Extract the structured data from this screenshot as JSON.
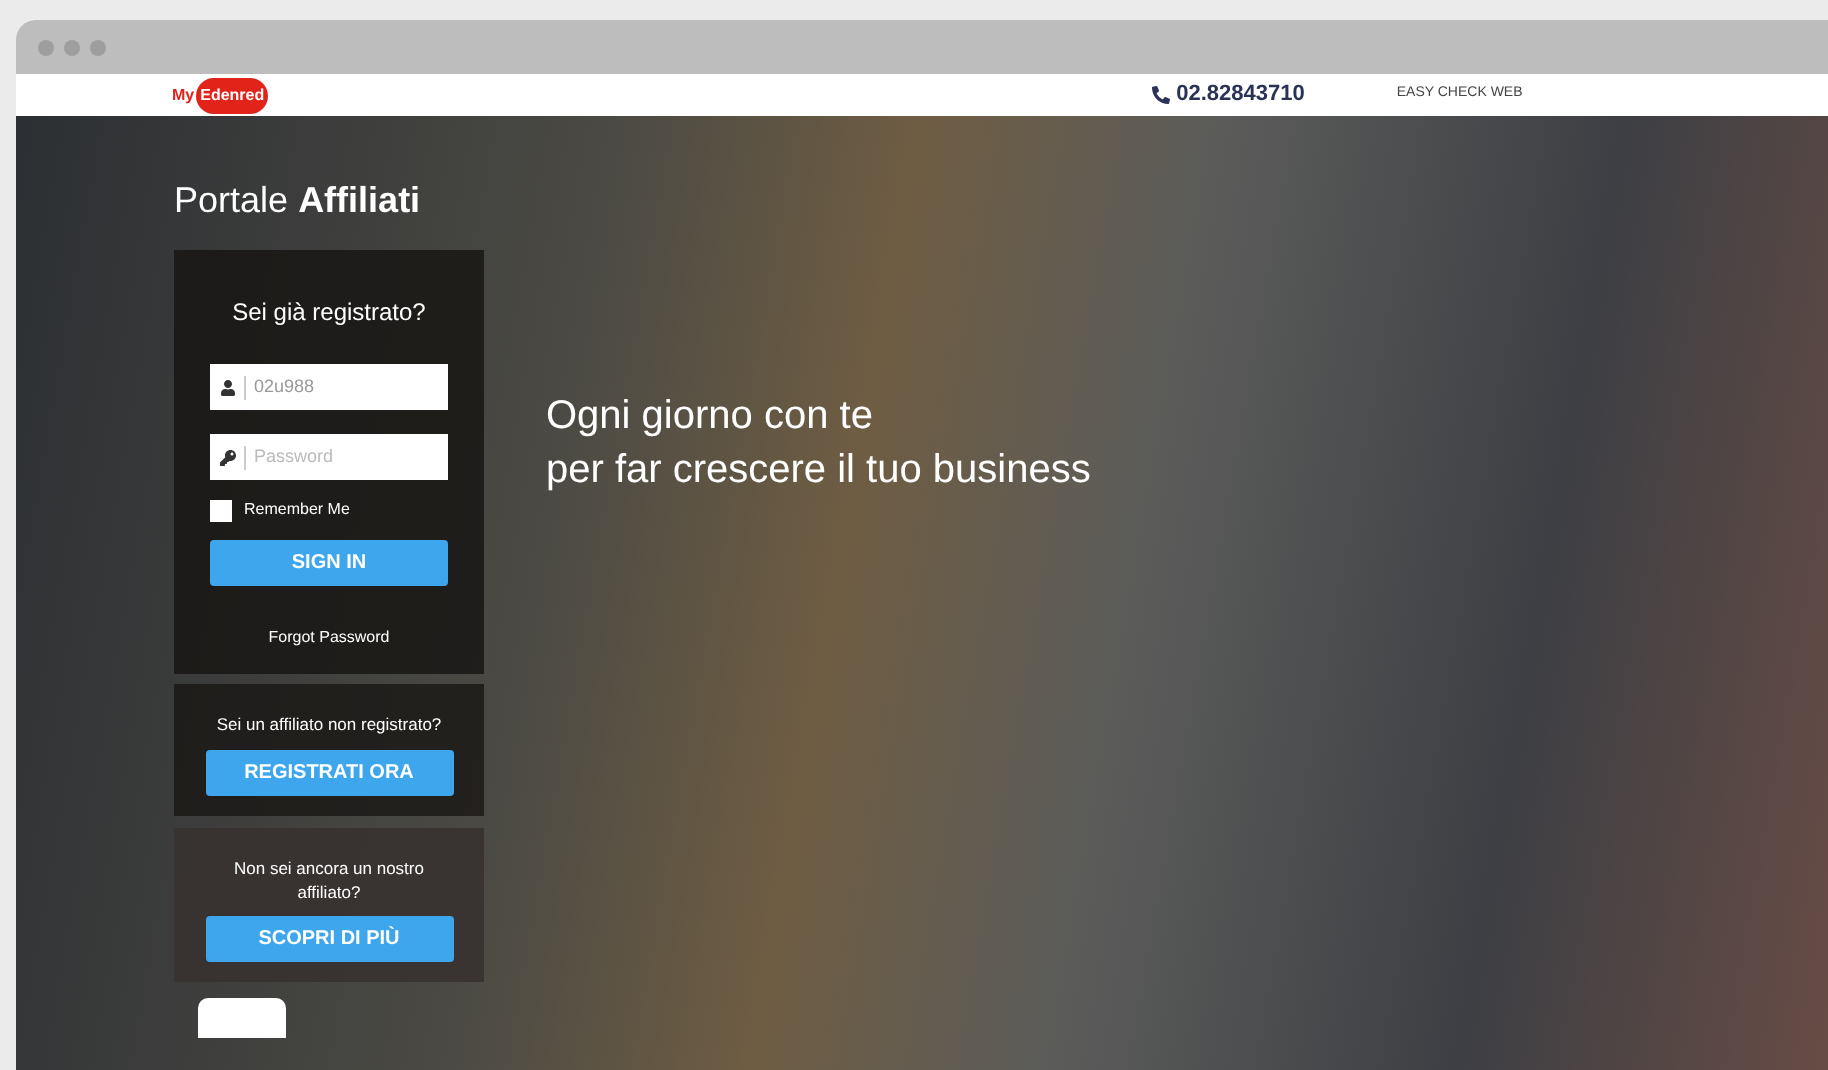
{
  "logo": {
    "prefix": "My",
    "brand": "Edenred"
  },
  "header": {
    "phone": "02.82843710",
    "link": "EASY CHECK WEB"
  },
  "portal_title": {
    "regular": "Portale",
    "bold": "Affiliati"
  },
  "login": {
    "heading": "Sei già registrato?",
    "username": {
      "value": "02u988"
    },
    "password": {
      "placeholder": "Password"
    },
    "remember": {
      "label": "Remember Me",
      "checked": false
    },
    "submit": "SIGN IN",
    "forgot": "Forgot Password"
  },
  "register": {
    "text": "Sei un affiliato non registrato?",
    "button": "REGISTRATI ORA"
  },
  "discover": {
    "text": "Non sei ancora un nostro affiliato?",
    "button": "SCOPRI DI PIÙ"
  },
  "hero": {
    "lines": [
      "Ogni giorno con te",
      "per far crescere il tuo business"
    ]
  }
}
